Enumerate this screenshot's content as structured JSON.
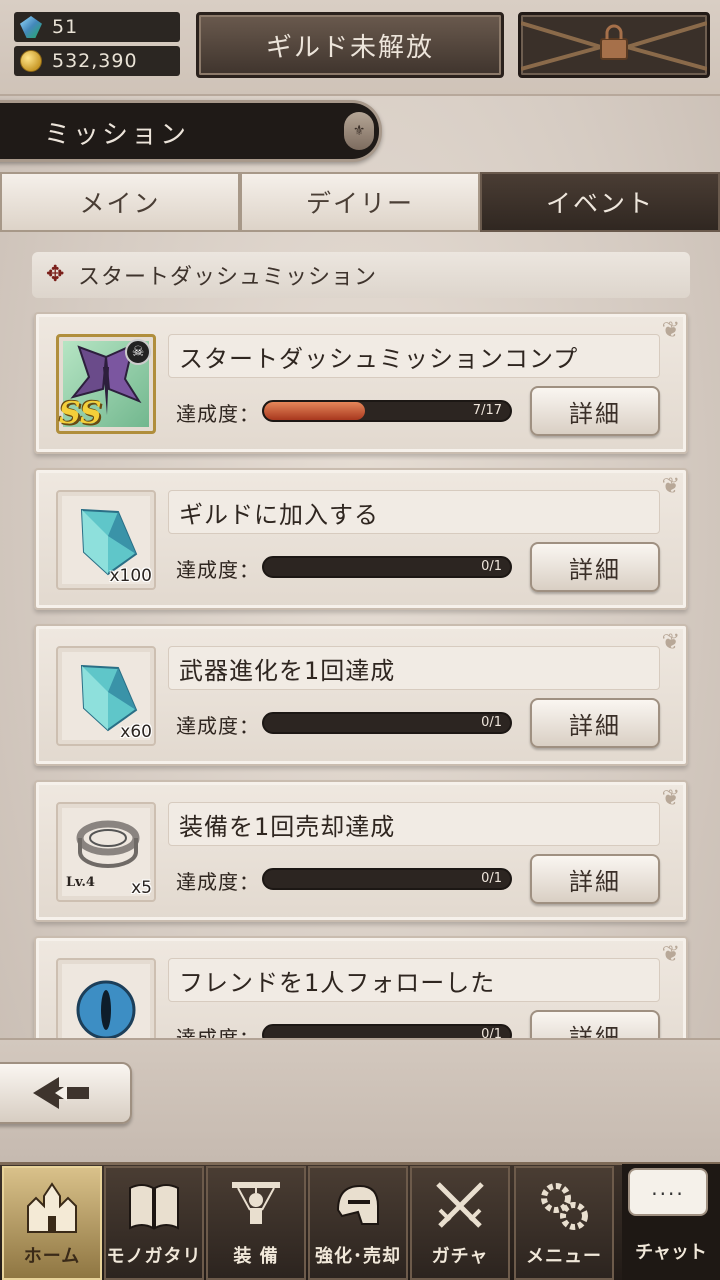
{
  "top": {
    "gems": "51",
    "coins": "532,390",
    "guild_button": "ギルド未解放"
  },
  "header": {
    "title": "ミッション"
  },
  "tabs": [
    {
      "label": "メイン",
      "active": false
    },
    {
      "label": "デイリー",
      "active": false
    },
    {
      "label": "イベント",
      "active": true
    }
  ],
  "section": {
    "title": "スタートダッシュミッション"
  },
  "progress_label": "達成度：",
  "detail_label": "詳細",
  "missions": [
    {
      "title": "スタートダッシュミッションコンプ",
      "progress": "7/17",
      "progress_value": 7,
      "progress_max": 17,
      "reward": "SS",
      "reward_icon": "butterfly-weapon-icon"
    },
    {
      "title": "ギルドに加入する",
      "progress": "0/1",
      "progress_value": 0,
      "progress_max": 1,
      "reward_qty": "x100",
      "reward_icon": "crystal-icon"
    },
    {
      "title": "武器進化を1回達成",
      "progress": "0/1",
      "progress_value": 0,
      "progress_max": 1,
      "reward_qty": "x60",
      "reward_icon": "crystal-icon"
    },
    {
      "title": "装備を1回売却達成",
      "progress": "0/1",
      "progress_value": 0,
      "progress_max": 1,
      "reward_qty": "x5",
      "reward_level": "Lv.4",
      "reward_icon": "ring-icon"
    },
    {
      "title": "フレンドを1人フォローした",
      "progress": "0/1",
      "progress_value": 0,
      "progress_max": 1,
      "reward_icon": "eye-orb-icon"
    }
  ],
  "nav": [
    {
      "label": "ホーム",
      "icon": "castle-icon",
      "active": true
    },
    {
      "label": "モノガタリ",
      "icon": "book-icon",
      "active": false
    },
    {
      "label": "装 備",
      "icon": "puppet-icon",
      "active": false
    },
    {
      "label": "強化･売却",
      "icon": "helmet-icon",
      "active": false
    },
    {
      "label": "ガチャ",
      "icon": "swords-icon",
      "active": false
    },
    {
      "label": "メニュー",
      "icon": "gears-icon",
      "active": false
    }
  ],
  "chat": {
    "bubble": "....",
    "label": "チャット"
  }
}
